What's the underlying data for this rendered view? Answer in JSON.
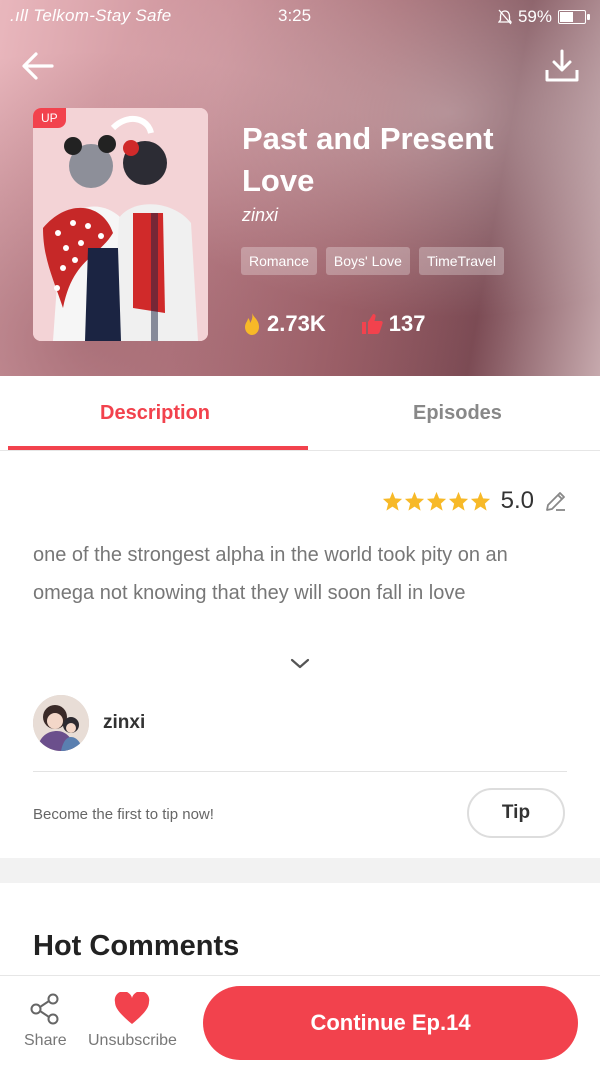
{
  "status_bar": {
    "carrier": ".ıll Telkom-Stay Safe",
    "time": "3:25",
    "battery": "59%",
    "battery_level": 0.59
  },
  "header": {
    "up_badge": "UP",
    "title": "Past and Present Love",
    "author": "zinxi",
    "tags": [
      "Romance",
      "Boys' Love",
      "TimeTravel"
    ],
    "views": "2.73K",
    "likes": "137"
  },
  "tabs": {
    "description": "Description",
    "episodes": "Episodes"
  },
  "rating": {
    "value": "5.0",
    "stars": 5
  },
  "description": "one of the strongest alpha in the world took pity on an omega not knowing that they will soon fall in love",
  "creator": {
    "name": "zinxi"
  },
  "tip": {
    "prompt": "Become the first to tip now!",
    "button": "Tip"
  },
  "comments": {
    "heading": "Hot Comments"
  },
  "bottom_bar": {
    "share": "Share",
    "unsubscribe": "Unsubscribe",
    "continue": "Continue Ep.14"
  },
  "colors": {
    "accent": "#f2424d",
    "star": "#f7b928"
  }
}
